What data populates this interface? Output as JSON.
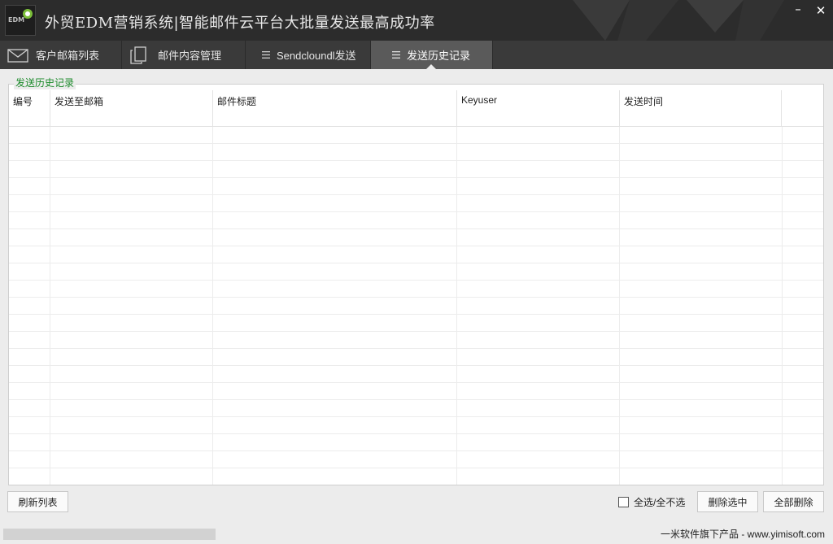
{
  "window": {
    "title": "外贸EDM营销系统|智能邮件云平台大批量发送最高成功率",
    "logo_text": "EDM",
    "min_glyph": "–",
    "close_glyph": "✕"
  },
  "tabs": [
    {
      "label": "客户邮箱列表",
      "icon": "envelope-icon",
      "active": false
    },
    {
      "label": "邮件内容管理",
      "icon": "copy-document-icon",
      "active": false
    },
    {
      "label": "Sendcloundl发送",
      "icon": "menu-lines-icon",
      "active": false
    },
    {
      "label": "发送历史记录",
      "icon": "menu-lines-icon",
      "active": true
    }
  ],
  "group": {
    "legend": "发送历史记录"
  },
  "table": {
    "columns": [
      "编号",
      "发送至邮箱",
      "邮件标题",
      "Keyuser",
      "发送时间",
      ""
    ],
    "rows": []
  },
  "controls": {
    "refresh_label": "刷新列表",
    "select_all_label": "全选/全不选",
    "select_all_checked": false,
    "delete_selected_label": "删除选中",
    "delete_all_label": "全部删除"
  },
  "status": {
    "progress": 0.0,
    "credit": "一米软件旗下产品 - www.yimisoft.com"
  },
  "colors": {
    "titlebar": "#2c2c2c",
    "tabbar": "#3a3a3a",
    "active_tab": "#5a5a5a",
    "legend_text": "#1b8a2a"
  }
}
